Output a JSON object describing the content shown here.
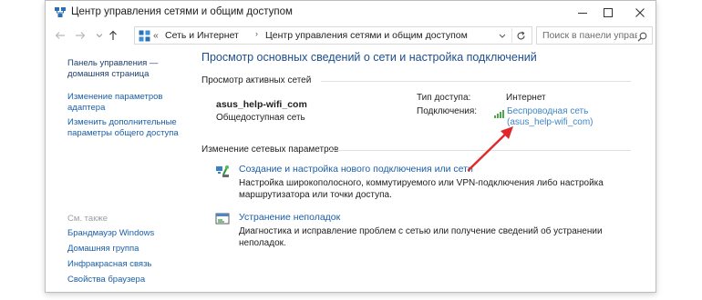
{
  "window": {
    "title": "Центр управления сетями и общим доступом"
  },
  "address": {
    "prefix": "«",
    "crumbs": [
      "Сеть и Интернет",
      "Центр управления сетями и общим доступом"
    ],
    "separator": "›"
  },
  "search": {
    "placeholder": "Поиск в панели управления"
  },
  "sidebar": {
    "home_line1": "Панель управления —",
    "home_line2": "домашняя страница",
    "adapter_line1": "Изменение параметров",
    "adapter_line2": "адаптера",
    "sharing_line1": "Изменить дополнительные",
    "sharing_line2": "параметры общего доступа",
    "see_also": "См. также",
    "see_also_links": [
      "Брандмауэр Windows",
      "Домашняя группа",
      "Инфракрасная связь",
      "Свойства браузера"
    ]
  },
  "main": {
    "title": "Просмотр основных сведений о сети и настройка подключений",
    "active_networks_header": "Просмотр активных сетей",
    "network_name": "asus_help-wifi_com",
    "network_category": "Общедоступная сеть",
    "access_type_label": "Тип доступа:",
    "access_type_value": "Интернет",
    "connections_label": "Подключения:",
    "connection_line1": "Беспроводная сеть",
    "connection_line2": "(asus_help-wifi_com)",
    "change_settings_header": "Изменение сетевых параметров",
    "tasks": [
      {
        "link": "Создание и настройка нового подключения или сети",
        "desc": "Настройка широкополосного, коммутируемого или VPN-подключения либо настройка маршрутизатора или точки доступа."
      },
      {
        "link": "Устранение неполадок",
        "desc": "Диагностика и исправление проблем с сетью или получение сведений об устранении неполадок."
      }
    ]
  },
  "colors": {
    "link": "#1a5ea8",
    "title": "#1e4e8c",
    "arrow": "#e0282a"
  }
}
